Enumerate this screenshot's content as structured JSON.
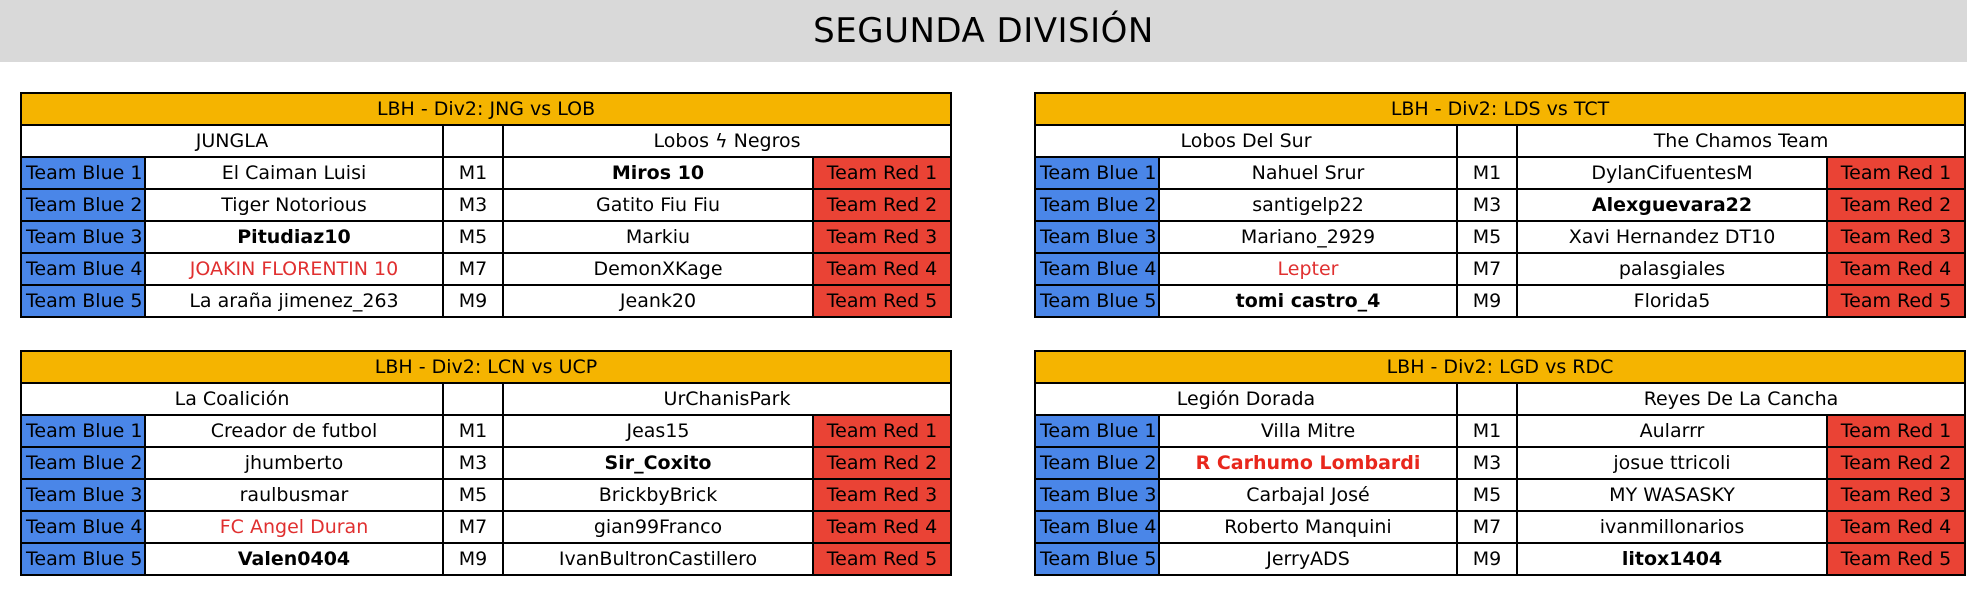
{
  "page": {
    "title": "SEGUNDA DIVISIÓN"
  },
  "colors": {
    "header_bar": "#d9d9d9",
    "table_header": "#f5b400",
    "blue_label": "#4a86e8",
    "red_label": "#ea4335",
    "red_text": "#e03030",
    "border": "#000000"
  },
  "labels": {
    "blue": [
      "Team Blue 1",
      "Team Blue 2",
      "Team Blue 3",
      "Team Blue 4",
      "Team Blue 5"
    ],
    "red": [
      "Team Red 1",
      "Team Red 2",
      "Team Red 3",
      "Team Red 4",
      "Team Red 5"
    ],
    "codes": [
      "M1",
      "M3",
      "M5",
      "M7",
      "M9"
    ]
  },
  "tables": [
    {
      "header": "LBH - Div2: JNG vs LOB",
      "team_left": "JUNGLA",
      "team_right": "Lobos ϟ Negros",
      "rows": [
        {
          "blue_label": "Team Blue 1",
          "left": "El Caiman Luisi",
          "left_style": "normal",
          "code": "M1",
          "right": "Miros 10",
          "right_style": "bold",
          "red_label": "Team Red 1"
        },
        {
          "blue_label": "Team Blue 2",
          "left": "Tiger Notorious",
          "left_style": "normal",
          "code": "M3",
          "right": "Gatito Fiu Fiu",
          "right_style": "normal",
          "red_label": "Team Red 2"
        },
        {
          "blue_label": "Team Blue 3",
          "left": "Pitudiaz10",
          "left_style": "bold",
          "code": "M5",
          "right": "Markiu",
          "right_style": "normal",
          "red_label": "Team Red 3"
        },
        {
          "blue_label": "Team Blue 4",
          "left": "JOAKIN FLORENTIN 10",
          "left_style": "red",
          "code": "M7",
          "right": "DemonXKage",
          "right_style": "normal",
          "red_label": "Team Red 4"
        },
        {
          "blue_label": "Team Blue 5",
          "left": "La araña jimenez_263",
          "left_style": "normal",
          "code": "M9",
          "right": "Jeank20",
          "right_style": "normal",
          "red_label": "Team Red 5"
        }
      ]
    },
    {
      "header": "LBH - Div2: LDS vs TCT",
      "team_left": "Lobos Del Sur",
      "team_right": "The Chamos Team",
      "rows": [
        {
          "blue_label": "Team Blue 1",
          "left": "Nahuel Srur",
          "left_style": "normal",
          "code": "M1",
          "right": "DylanCifuentesM",
          "right_style": "normal",
          "red_label": "Team Red 1"
        },
        {
          "blue_label": "Team Blue 2",
          "left": "santigelp22",
          "left_style": "normal",
          "code": "M3",
          "right": "Alexguevara22",
          "right_style": "bold",
          "red_label": "Team Red 2"
        },
        {
          "blue_label": "Team Blue 3",
          "left": "Mariano_2929",
          "left_style": "normal",
          "code": "M5",
          "right": "Xavi Hernandez DT10",
          "right_style": "normal",
          "red_label": "Team Red 3"
        },
        {
          "blue_label": "Team Blue 4",
          "left": "Lepter",
          "left_style": "red",
          "code": "M7",
          "right": "palasgiales",
          "right_style": "normal",
          "red_label": "Team Red 4"
        },
        {
          "blue_label": "Team Blue 5",
          "left": "tomi castro_4",
          "left_style": "bold",
          "code": "M9",
          "right": "Florida5",
          "right_style": "normal",
          "red_label": "Team Red 5"
        }
      ]
    },
    {
      "header": "LBH - Div2: LCN vs UCP",
      "team_left": "La Coalición",
      "team_right": "UrChanisPark",
      "rows": [
        {
          "blue_label": "Team Blue 1",
          "left": "Creador de futbol",
          "left_style": "normal",
          "code": "M1",
          "right": "Jeas15",
          "right_style": "normal",
          "red_label": "Team Red 1"
        },
        {
          "blue_label": "Team Blue 2",
          "left": "jhumberto",
          "left_style": "normal",
          "code": "M3",
          "right": "Sir_Coxito",
          "right_style": "bold",
          "red_label": "Team Red 2"
        },
        {
          "blue_label": "Team Blue 3",
          "left": "raulbusmar",
          "left_style": "normal",
          "code": "M5",
          "right": "BrickbyBrick",
          "right_style": "normal",
          "red_label": "Team Red 3"
        },
        {
          "blue_label": "Team Blue 4",
          "left": "FC Angel Duran",
          "left_style": "red",
          "code": "M7",
          "right": "gian99Franco",
          "right_style": "normal",
          "red_label": "Team Red 4"
        },
        {
          "blue_label": "Team Blue 5",
          "left": "Valen0404",
          "left_style": "bold",
          "code": "M9",
          "right": "IvanBultronCastillero",
          "right_style": "normal",
          "red_label": "Team Red 5"
        }
      ]
    },
    {
      "header": "LBH - Div2: LGD vs RDC",
      "team_left": "Legión Dorada",
      "team_right": "Reyes De La Cancha",
      "rows": [
        {
          "blue_label": "Team Blue 1",
          "left": "Villa Mitre",
          "left_style": "normal",
          "code": "M1",
          "right": "Aularrr",
          "right_style": "normal",
          "red_label": "Team Red 1"
        },
        {
          "blue_label": "Team Blue 2",
          "left": "R Carhumo Lombardi",
          "left_style": "red-bold",
          "code": "M3",
          "right": "josue ttricoli",
          "right_style": "normal",
          "red_label": "Team Red 2"
        },
        {
          "blue_label": "Team Blue 3",
          "left": "Carbajal José",
          "left_style": "normal",
          "code": "M5",
          "right": "MY WASASKY",
          "right_style": "normal",
          "red_label": "Team Red 3"
        },
        {
          "blue_label": "Team Blue 4",
          "left": "Roberto Manquini",
          "left_style": "normal",
          "code": "M7",
          "right": "ivanmillonarios",
          "right_style": "normal",
          "red_label": "Team Red 4"
        },
        {
          "blue_label": "Team Blue 5",
          "left": "JerryADS",
          "left_style": "normal",
          "code": "M9",
          "right": "litox1404",
          "right_style": "bold",
          "red_label": "Team Red 5"
        }
      ]
    }
  ]
}
